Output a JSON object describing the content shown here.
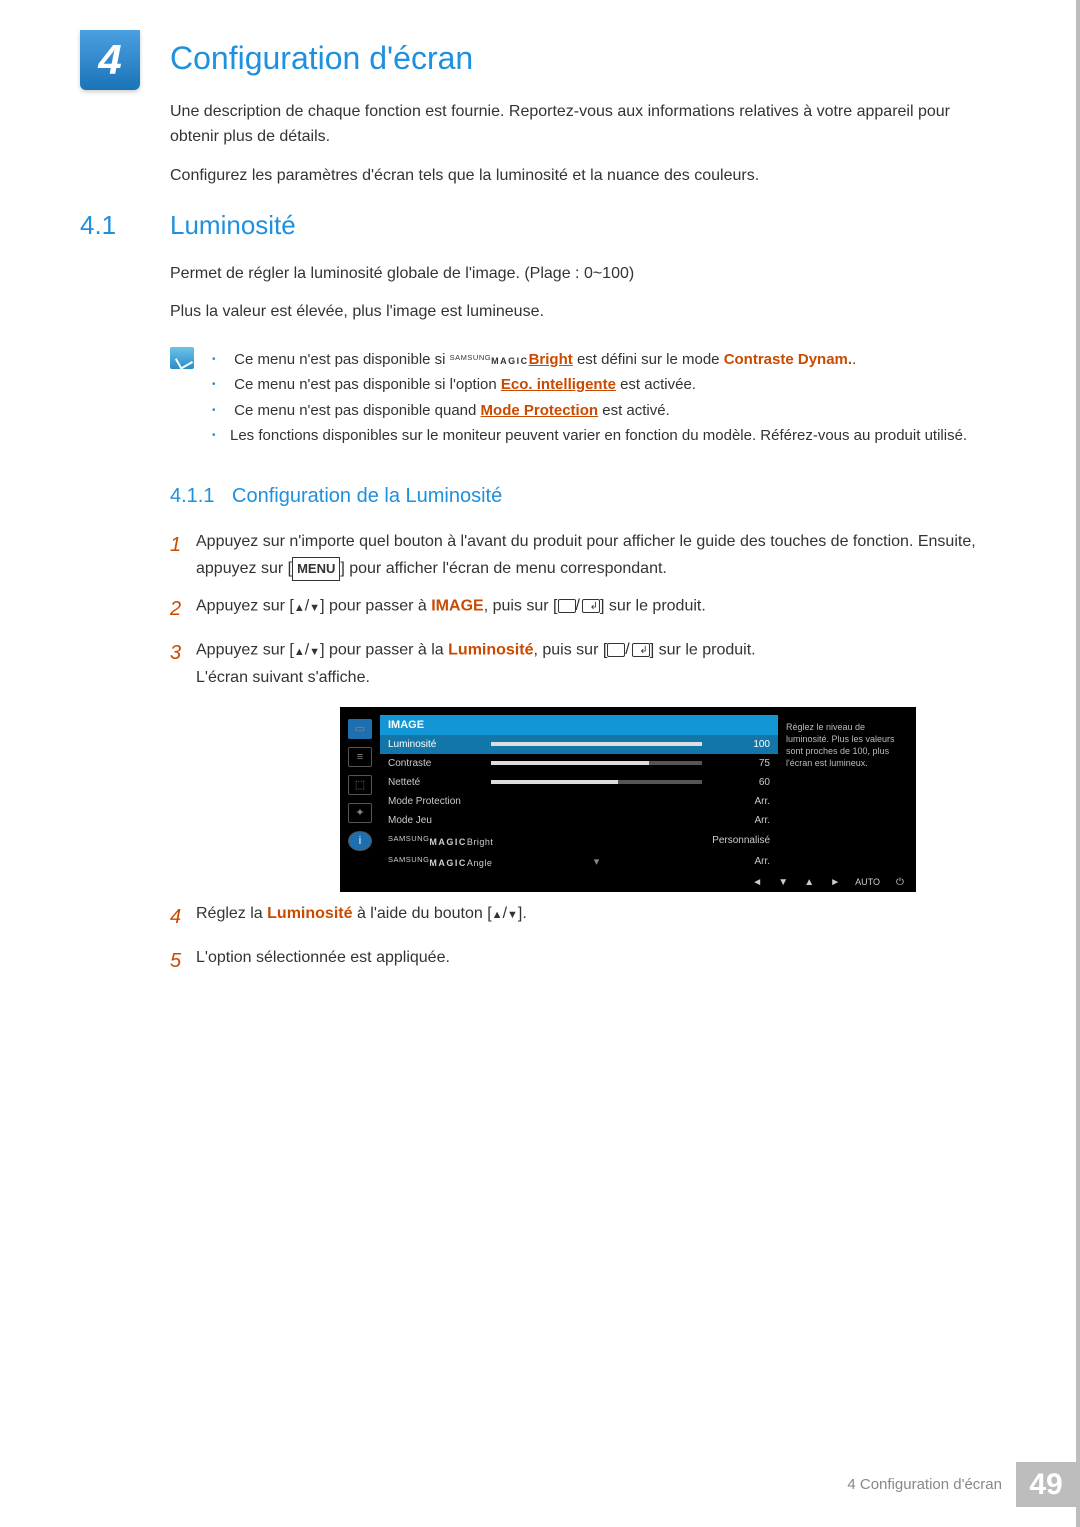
{
  "chapter": {
    "number": "4",
    "title": "Configuration d'écran"
  },
  "intro": {
    "p1": "Une description de chaque fonction est fournie. Reportez-vous aux informations relatives à votre appareil pour obtenir plus de détails.",
    "p2": "Configurez les paramètres d'écran tels que la luminosité et la nuance des couleurs."
  },
  "section": {
    "number": "4.1",
    "title": "Luminosité",
    "p1": "Permet de régler la luminosité globale de l'image. (Plage : 0~100)",
    "p2": "Plus la valeur est élevée, plus l'image est lumineuse."
  },
  "notes": {
    "n1_a": "Ce menu n'est pas disponible si ",
    "n1_brand_small": "SAMSUNG",
    "n1_brand_big": "MAGIC",
    "n1_brand_name": "Bright",
    "n1_b": " est défini sur le mode ",
    "n1_c": "Contraste Dynam.",
    "n1_d": ".",
    "n2_a": "Ce menu n'est pas disponible si l'option ",
    "n2_link": "Eco. intelligente",
    "n2_b": " est activée.",
    "n3_a": "Ce menu n'est pas disponible quand ",
    "n3_link": "Mode Protection",
    "n3_b": " est activé.",
    "n4": "Les fonctions disponibles sur le moniteur peuvent varier en fonction du modèle. Référez-vous au produit utilisé."
  },
  "subsection": {
    "number": "4.1.1",
    "title": "Configuration de la Luminosité"
  },
  "steps": {
    "s1_a": "Appuyez sur n'importe quel bouton à l'avant du produit pour afficher le guide des touches de fonction. Ensuite, appuyez sur [",
    "s1_menu": "MENU",
    "s1_b": "] pour afficher l'écran de menu correspondant.",
    "s2_a": "Appuyez sur [",
    "s2_b": "] pour passer à ",
    "s2_img": "IMAGE",
    "s2_c": ", puis sur [",
    "s2_d": "] sur le produit.",
    "s3_a": "Appuyez sur [",
    "s3_b": "] pour passer à la ",
    "s3_lum": "Luminosité",
    "s3_c": ", puis sur [",
    "s3_d": "] sur le produit.",
    "s3_e": "L'écran suivant s'affiche.",
    "s4_a": "Réglez la ",
    "s4_lum": "Luminosité",
    "s4_b": " à l'aide du bouton [",
    "s4_c": "].",
    "s5": "L'option sélectionnée est appliquée.",
    "num1": "1",
    "num2": "2",
    "num3": "3",
    "num4": "4",
    "num5": "5"
  },
  "osd": {
    "header": "IMAGE",
    "tip": "Réglez le niveau de luminosité. Plus les valeurs sont proches de 100, plus l'écran est lumineux.",
    "rows": {
      "r1_label": "Luminosité",
      "r1_val": "100",
      "r2_label": "Contraste",
      "r2_val": "75",
      "r3_label": "Netteté",
      "r3_val": "60",
      "r4_label": "Mode Protection",
      "r4_val": "Arr.",
      "r5_label": "Mode Jeu",
      "r5_val": "Arr.",
      "r6_val": "Personnalisé",
      "r7_val": "Arr."
    },
    "brand_small": "SAMSUNG",
    "brand_big": "MAGIC",
    "brand_bright": "Bright",
    "brand_angle": "Angle",
    "footer_auto": "AUTO"
  },
  "footer": {
    "breadcrumb": "4 Configuration d'écran",
    "page": "49"
  }
}
